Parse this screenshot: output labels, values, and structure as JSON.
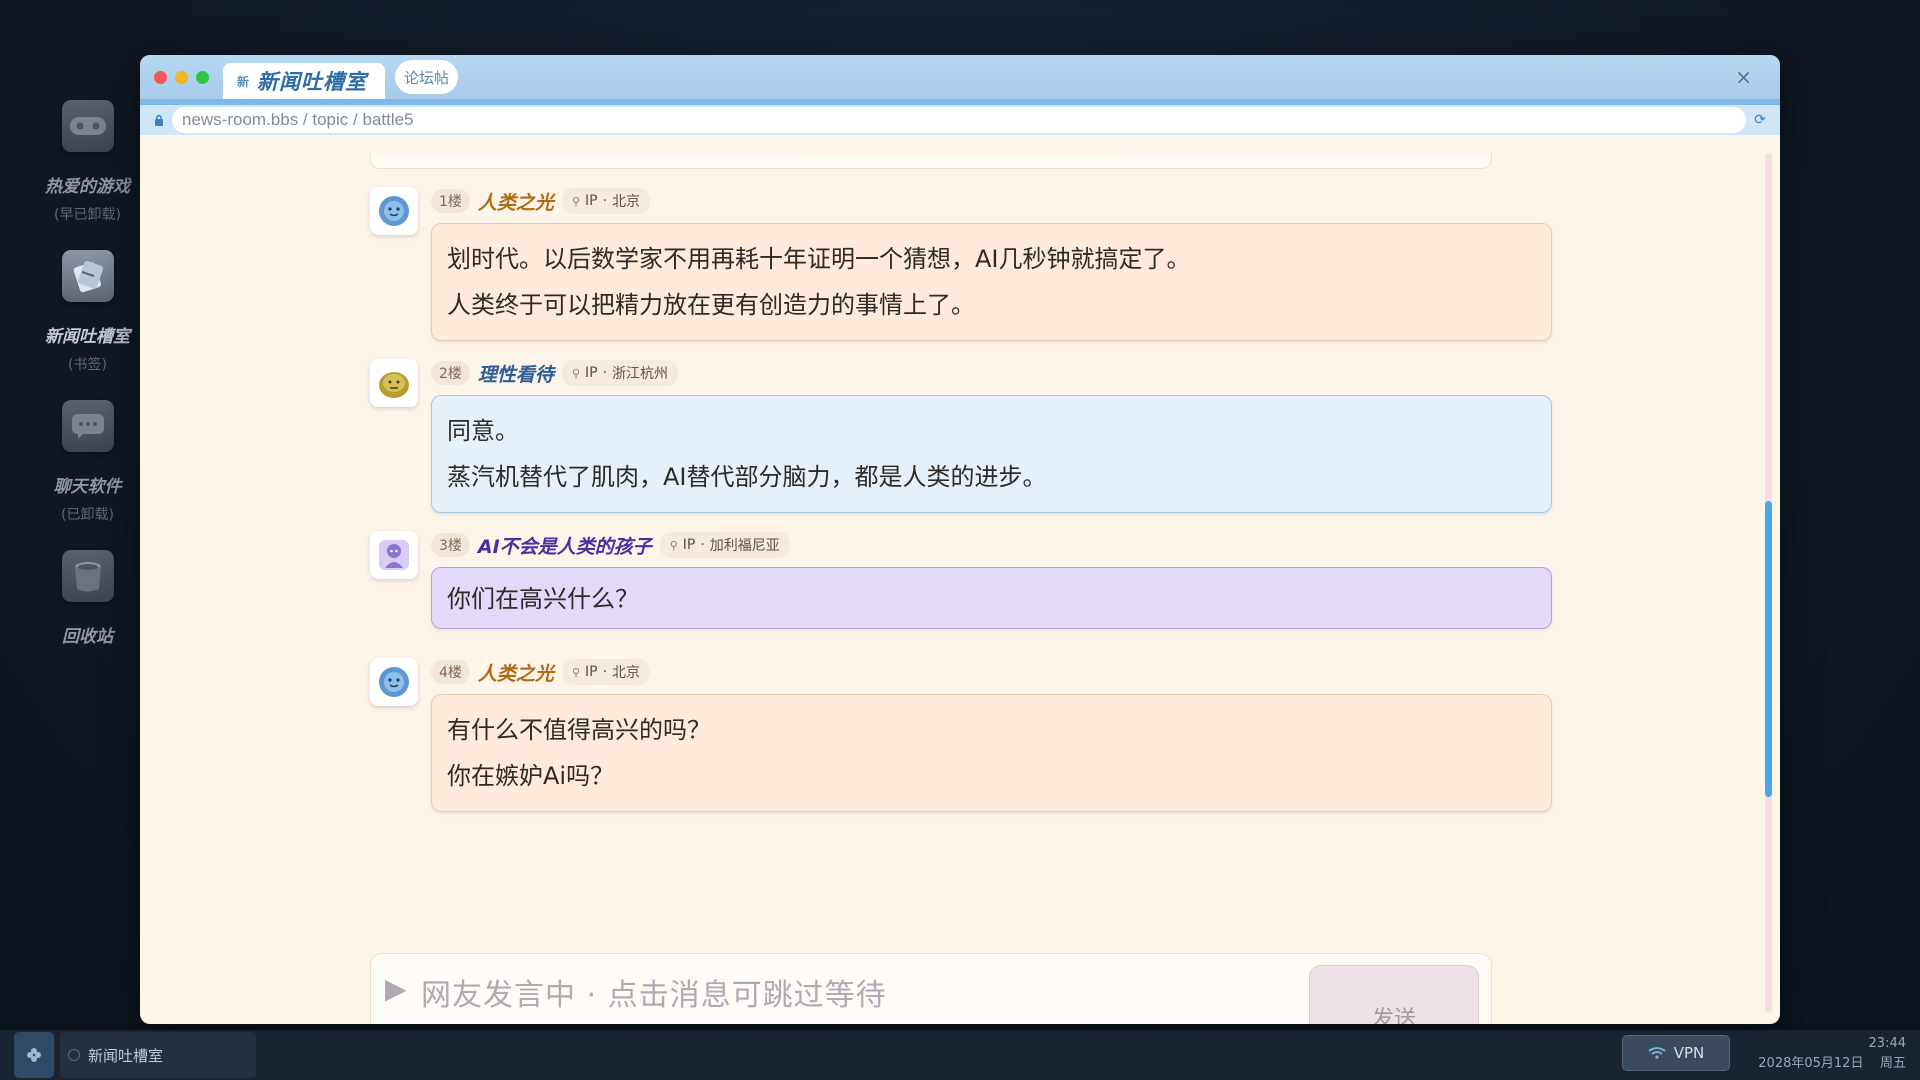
{
  "desktop": {
    "icons": [
      {
        "name": "热爱的游戏",
        "sub": "(早已卸载)"
      },
      {
        "name": "新闻吐槽室",
        "sub": "(书签)"
      },
      {
        "name": "聊天软件",
        "sub": "(已卸载)"
      },
      {
        "name": "回收站",
        "sub": ""
      }
    ]
  },
  "window": {
    "tab_mark": "新",
    "tab_title": "新闻吐槽室",
    "tab_pill": "论坛帖",
    "close": "×",
    "url": "news-room.bbs / topic / battle5"
  },
  "posts": [
    {
      "floor": "1楼",
      "user": "人类之光",
      "user_color": "#b06a12",
      "ip_prefix": "IP",
      "ip_loc": "北京",
      "style": "orange",
      "lines": [
        "划时代。以后数学家不用再耗十年证明一个猜想，AI几秒钟就搞定了。",
        "人类终于可以把精力放在更有创造力的事情上了。"
      ]
    },
    {
      "floor": "2楼",
      "user": "理性看待",
      "user_color": "#2d5f96",
      "ip_prefix": "IP",
      "ip_loc": "浙江杭州",
      "style": "blue",
      "lines": [
        "同意。",
        "蒸汽机替代了肌肉，AI替代部分脑力，都是人类的进步。"
      ]
    },
    {
      "floor": "3楼",
      "user": "AI不会是人类的孩子",
      "user_color": "#4b2fa0",
      "ip_prefix": "IP",
      "ip_loc": "加利福尼亚",
      "style": "purple",
      "lines": [
        "你们在高兴什么？"
      ]
    },
    {
      "floor": "4楼",
      "user": "人类之光",
      "user_color": "#b06a12",
      "ip_prefix": "IP",
      "ip_loc": "北京",
      "style": "orange",
      "lines": [
        "有什么不值得高兴的吗？",
        "你在嫉妒Ai吗？"
      ]
    }
  ],
  "composer": {
    "hint": "网友发言中 · 点击消息可跳过等待",
    "send": "发送"
  },
  "taskbar": {
    "app": "新闻吐槽室",
    "vpn": "VPN",
    "time": "23:44",
    "date": "2028年05月12日",
    "weekday": "周五"
  },
  "colors": {
    "titlebar": "#b7d8f3",
    "scroll_thumb": "#4aa6e8",
    "window_bg": "#fdf4ea"
  }
}
